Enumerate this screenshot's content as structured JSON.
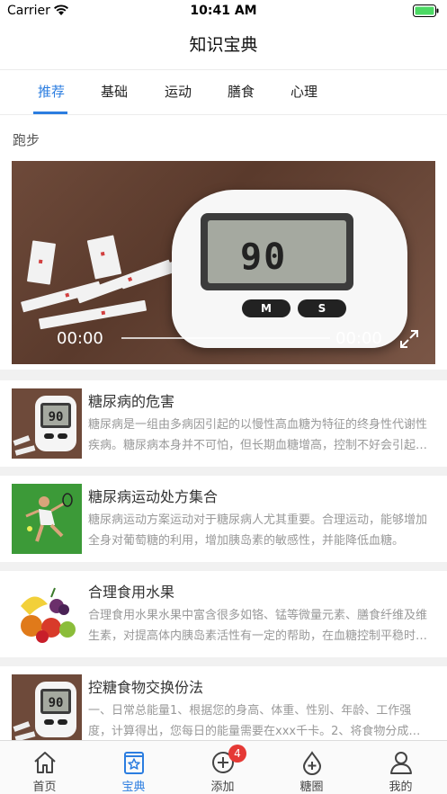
{
  "status_bar": {
    "carrier": "Carrier",
    "time": "10:41 AM"
  },
  "nav": {
    "title": "知识宝典"
  },
  "tabs": [
    {
      "label": "推荐",
      "active": true
    },
    {
      "label": "基础",
      "active": false
    },
    {
      "label": "运动",
      "active": false
    },
    {
      "label": "膳食",
      "active": false
    },
    {
      "label": "心理",
      "active": false
    }
  ],
  "featured": {
    "section_title": "跑步",
    "video": {
      "meter_reading": "90",
      "meter_buttons": [
        "M",
        "S"
      ],
      "current_time": "00:00",
      "duration": "00:00",
      "progress": 0
    }
  },
  "articles": [
    {
      "title": "糖尿病的危害",
      "desc": "糖尿病是一组由多病因引起的以慢性高血糖为特征的终身性代谢性疾病。糖尿病本身并不可怕，但长期血糖增高，控制不好会引起多种并发症。",
      "thumb": "glucose-meter",
      "thumb_reading": "90"
    },
    {
      "title": "糖尿病运动处方集合",
      "desc": "糖尿病运动方案运动对于糖尿病人尤其重要。合理运动，能够增加全身对葡萄糖的利用，增加胰岛素的敏感性，并能降低血糖。",
      "thumb": "tennis-player"
    },
    {
      "title": "合理食用水果",
      "desc": "合理食用水果水果中富含很多如铬、锰等微量元素、膳食纤维及维生素，对提高体内胰岛素活性有一定的帮助，在血糖控制平稳时可以适量食用。",
      "thumb": "fruits"
    },
    {
      "title": "控糖食物交换份法",
      "desc": "一、日常总能量1、根据您的身高、体重、性别、年龄、工作强度，计算得出，您每日的能量需要在xxx千卡。2、将食物分成四大类。",
      "thumb": "glucose-meter",
      "thumb_reading": "90"
    }
  ],
  "tabbar": {
    "items": [
      {
        "label": "首页",
        "icon": "home-icon",
        "active": false
      },
      {
        "label": "宝典",
        "icon": "book-star-icon",
        "active": true
      },
      {
        "label": "添加",
        "icon": "plus-circle-icon",
        "active": false
      },
      {
        "label": "糖圈",
        "icon": "drop-plus-icon",
        "active": false
      },
      {
        "label": "我的",
        "icon": "person-icon",
        "active": false
      }
    ],
    "badge": "4"
  },
  "colors": {
    "accent": "#2b7de0",
    "badge": "#e53935",
    "separator": "#f1f1f1"
  }
}
